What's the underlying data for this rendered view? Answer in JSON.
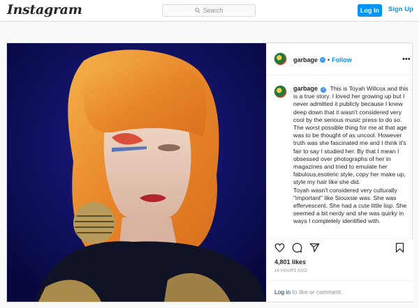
{
  "header": {
    "logo_text": "Instagram",
    "search_placeholder": "Search",
    "login_label": "Log In",
    "signup_label": "Sign Up"
  },
  "post": {
    "username": "garbage",
    "verified": true,
    "follow_label": "Follow",
    "separator": "•",
    "more_label": "•••",
    "caption": "This is Toyah Willcox and this is a true story. I loved her growing up but I never admitted it publicly because I knew deep down that it wasn't considered very cool by the serious music press to do so. The worst possible thing for me at that age was to be thought of as uncool. However truth was she fascinated me and I think it's fair to say I studied her. By that I mean I obsessed over photographs of her in magazines and tried to emulate her fabulous,esoteric style, copy her make up, style my hair like she did.\nToyah wasn't considered very culturally \"important\" like Siouxsie was. She was effervescent. She had a cute little lisp. She seemed a bit nerdy and she was quirky in ways I completely identified with.",
    "likes": "4,801 likes",
    "timestamp": "16 HOURS AGO",
    "login_link": "Log in",
    "login_suffix": " to like or comment."
  },
  "icons": {
    "search": "search-icon",
    "verified": "verified-badge-icon",
    "more": "more-options-icon",
    "like": "heart-icon",
    "comment": "comment-icon",
    "share": "share-icon",
    "save": "bookmark-icon"
  },
  "colors": {
    "accent": "#0095f6",
    "link": "#00376b",
    "photo_background": "#0c0b55",
    "hair": "#e8922a"
  }
}
